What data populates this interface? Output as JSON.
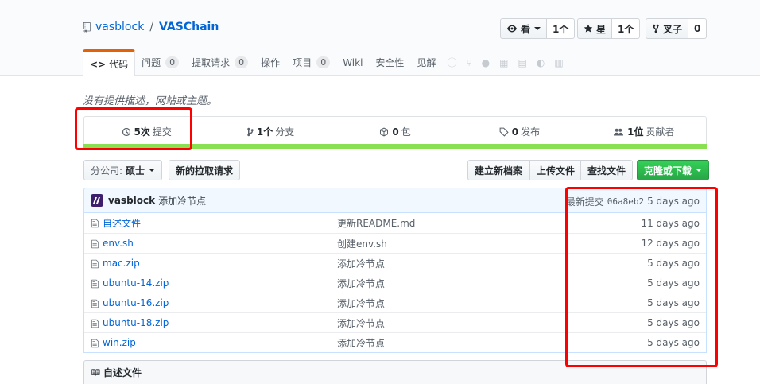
{
  "repo": {
    "owner": "vasblock",
    "separator": "/",
    "name": "VASChain"
  },
  "social": {
    "watch": {
      "label": "看",
      "count": "1个"
    },
    "star": {
      "label": "星",
      "count": "1个"
    },
    "fork": {
      "label": "叉子",
      "count": "0"
    }
  },
  "tabs": [
    {
      "label": "代码",
      "selected": true
    },
    {
      "label": "问题",
      "counter": "0"
    },
    {
      "label": "提取请求",
      "counter": "0"
    },
    {
      "label": "操作"
    },
    {
      "label": "项目",
      "counter": "0"
    },
    {
      "label": "Wiki"
    },
    {
      "label": "安全性"
    },
    {
      "label": "见解"
    }
  ],
  "description": "没有提供描述，网站或主题。",
  "numbers": {
    "commits": {
      "value": "5次",
      "label": "提交"
    },
    "branches": {
      "value": "1个",
      "label": "分支"
    },
    "packages": {
      "value": "0",
      "label": "包"
    },
    "releases": {
      "value": "0",
      "label": "发布"
    },
    "contributors": {
      "value": "1位",
      "label": "贡献者"
    }
  },
  "language_bar_color": "#89e051",
  "file_nav": {
    "branch_prefix": "分公司:",
    "branch_name": "硕士",
    "new_pull_request": "新的拉取请求",
    "create_file": "建立新档案",
    "upload_files": "上传文件",
    "find_file": "查找文件",
    "clone_download": "克隆或下载"
  },
  "latest_commit": {
    "author": "vasblock",
    "message": "添加冷节点",
    "prefix": "最新提交",
    "sha": "06a8eb2",
    "age": "5 days ago"
  },
  "files": [
    {
      "name": "自述文件",
      "message": "更新README.md",
      "age": "11 days ago"
    },
    {
      "name": "env.sh",
      "message": "创建env.sh",
      "age": "12 days ago"
    },
    {
      "name": "mac.zip",
      "message": "添加冷节点",
      "age": "5 days ago"
    },
    {
      "name": "ubuntu-14.zip",
      "message": "添加冷节点",
      "age": "5 days ago"
    },
    {
      "name": "ubuntu-16.zip",
      "message": "添加冷节点",
      "age": "5 days ago"
    },
    {
      "name": "ubuntu-18.zip",
      "message": "添加冷节点",
      "age": "5 days ago"
    },
    {
      "name": "win.zip",
      "message": "添加冷节点",
      "age": "5 days ago"
    }
  ],
  "readme_title": "自述文件",
  "colors": {
    "link": "#0366d6",
    "highlight": "#ff0000",
    "selected_tab_border": "#e36209",
    "green_button": "#28a745"
  }
}
